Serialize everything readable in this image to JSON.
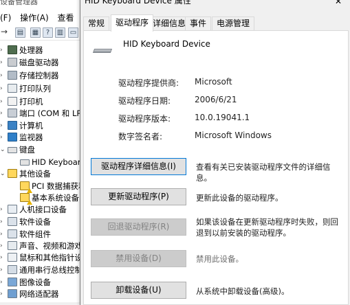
{
  "device_manager": {
    "title": "设备管理器",
    "menu": [
      "(F)",
      "操作(A)",
      "查看"
    ],
    "toolbar": {
      "back": "←",
      "forward": "→"
    },
    "tree": [
      {
        "label": "处理器",
        "icon": "cpu-icon",
        "expanded": false
      },
      {
        "label": "磁盘驱动器",
        "icon": "disk-icon",
        "expanded": false
      },
      {
        "label": "存储控制器",
        "icon": "storage-controller-icon",
        "expanded": false
      },
      {
        "label": "打印队列",
        "icon": "print-queue-icon",
        "expanded": false
      },
      {
        "label": "打印机",
        "icon": "printer-icon",
        "expanded": false
      },
      {
        "label": "端口 (COM 和 LPT)",
        "icon": "port-icon",
        "expanded": false
      },
      {
        "label": "计算机",
        "icon": "computer-icon",
        "expanded": false
      },
      {
        "label": "监视器",
        "icon": "monitor-icon",
        "expanded": false
      },
      {
        "label": "键盘",
        "icon": "keyboard-icon",
        "expanded": true
      },
      {
        "label": "HID Keyboard Device",
        "icon": "keyboard-icon",
        "child": true,
        "selected": true
      },
      {
        "label": "其他设备",
        "icon": "other-devices-icon",
        "expanded": true
      },
      {
        "label": "PCI 数据捕获和信号处理控制器",
        "icon": "unknown-device-icon",
        "child": true,
        "warning": true
      },
      {
        "label": "基本系统设备",
        "icon": "unknown-device-icon",
        "child": true,
        "warning": true
      },
      {
        "label": "人机接口设备",
        "icon": "hid-icon",
        "expanded": false
      },
      {
        "label": "软件设备",
        "icon": "software-device-icon",
        "expanded": false
      },
      {
        "label": "软件组件",
        "icon": "software-component-icon",
        "expanded": false
      },
      {
        "label": "声音、视频和游戏控制器",
        "icon": "audio-icon",
        "expanded": false
      },
      {
        "label": "鼠标和其他指针设备",
        "icon": "mouse-icon",
        "expanded": false
      },
      {
        "label": "通用串行总线控制器",
        "icon": "usb-icon",
        "expanded": false
      },
      {
        "label": "图像设备",
        "icon": "imaging-icon",
        "expanded": false
      },
      {
        "label": "网络适配器",
        "icon": "network-icon",
        "expanded": false
      }
    ]
  },
  "dialog": {
    "title": "HID Keyboard Device 属性",
    "close": "✕",
    "tabs": [
      {
        "label": "常规",
        "active": false
      },
      {
        "label": "驱动程序",
        "active": true
      },
      {
        "label": "详细信息",
        "active": false
      },
      {
        "label": "事件",
        "active": false
      },
      {
        "label": "电源管理",
        "active": false
      }
    ],
    "device_name": "HID Keyboard Device",
    "properties": [
      {
        "label": "驱动程序提供商:",
        "value": "Microsoft"
      },
      {
        "label": "驱动程序日期:",
        "value": "2006/6/21"
      },
      {
        "label": "驱动程序版本:",
        "value": "10.0.19041.1"
      },
      {
        "label": "数字签名者:",
        "value": "Microsoft Windows"
      }
    ],
    "actions": [
      {
        "button": "驱动程序详细信息(I)",
        "description": "查看有关已安装驱动程序文件的详细信息。",
        "enabled": true,
        "focused": true
      },
      {
        "button": "更新驱动程序(P)",
        "description": "更新此设备的驱动程序。",
        "enabled": true
      },
      {
        "button": "回退驱动程序(R)",
        "description": "如果该设备在更新驱动程序时失败，则回退到以前安装的驱动程序。",
        "enabled": false
      },
      {
        "button": "禁用设备(D)",
        "description": "禁用此设备。",
        "enabled": false
      },
      {
        "button": "卸载设备(U)",
        "description": "从系统中卸载设备(高级)。",
        "enabled": true
      }
    ]
  }
}
